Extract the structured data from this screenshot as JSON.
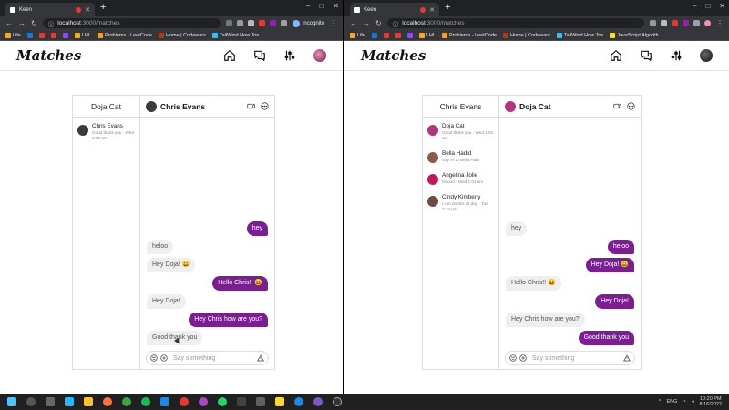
{
  "colors": {
    "accent": "#7a1f8f",
    "incoming": "#efefef",
    "chrome_dark": "#202124"
  },
  "taskbar": {
    "lang": "ENG",
    "time": "10:20 PM",
    "date": "8/16/2022",
    "apps": [
      "start",
      "search",
      "task-view",
      "widgets",
      "explorer",
      "firefox",
      "chrome",
      "spotify",
      "vscode",
      "chrome-2",
      "chrome-3",
      "whatsapp",
      "terminal",
      "notes",
      "sticky",
      "chrome-4",
      "discord",
      "obs"
    ]
  },
  "left": {
    "browser": {
      "tab_title": "Keen",
      "url_host": "localhost",
      "url_path": ":3000/matches",
      "incognito_label": "Incognito",
      "bookmarks": [
        "Life",
        "LHL",
        "Problems - LeetCode",
        "Home | Codewars",
        "TailWind How Tos"
      ]
    },
    "app": {
      "brand": "Matches"
    },
    "chat": {
      "sidebar_title": "Doja Cat",
      "contacts": [
        {
          "name": "Chris Evans",
          "meta": "Good thank you · Wed 1:02 am",
          "color": "#3b3b3b"
        }
      ],
      "header_name": "Chris Evans",
      "messages": [
        {
          "dir": "out",
          "text": "hey"
        },
        {
          "dir": "in",
          "text": "heloo"
        },
        {
          "dir": "in",
          "text": "Hey Doja! 😀"
        },
        {
          "dir": "out",
          "text": "Hello Chris!! 😀"
        },
        {
          "dir": "in",
          "text": "Hey Doja!"
        },
        {
          "dir": "out",
          "text": "Hey Chris how are you?"
        },
        {
          "dir": "in",
          "text": "Good thank you"
        }
      ],
      "placeholder": "Say something"
    }
  },
  "right": {
    "browser": {
      "tab_title": "Keen",
      "url_host": "localhost",
      "url_path": ":3000/matches",
      "bookmarks": [
        "Life",
        "LHL",
        "Problems - LeetCode",
        "Home | Codewars",
        "TailWind How Tos",
        "JavaScript Algorith..."
      ]
    },
    "app": {
      "brand": "Matches"
    },
    "chat": {
      "sidebar_title": "Chris Evans",
      "contacts": [
        {
          "name": "Doja Cat",
          "meta": "Good thank you · Wed 1:02 am",
          "color": "#b0357d"
        },
        {
          "name": "Bella Hadid",
          "meta": "Say Hi to Bella Hadi",
          "color": "#8d5a4a"
        },
        {
          "name": "Angelina Jolie",
          "meta": "helooo · Wed 1:01 am",
          "color": "#c2185b"
        },
        {
          "name": "Cindy Kimberly",
          "meta": "i can do this all day · Tue 7:23 pm",
          "color": "#6d4c41"
        }
      ],
      "header_name": "Doja Cat",
      "messages": [
        {
          "dir": "in",
          "text": "hey"
        },
        {
          "dir": "out",
          "text": "heloo"
        },
        {
          "dir": "out",
          "text": "Hey Doja! 😀"
        },
        {
          "dir": "in",
          "text": "Hello Chris!! 😀"
        },
        {
          "dir": "out",
          "text": "Hey Doja!"
        },
        {
          "dir": "in",
          "text": "Hey Chris how are you?"
        },
        {
          "dir": "out",
          "text": "Good thank you"
        }
      ],
      "placeholder": "Say something"
    }
  }
}
